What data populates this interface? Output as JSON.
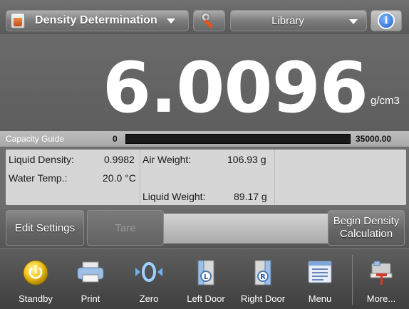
{
  "header": {
    "app_mode": "Density Determination",
    "library_label": "Library",
    "tools_icon": "wrench-icon",
    "info_icon": "info-icon",
    "info_glyph": "i"
  },
  "reading": {
    "value": "6.0096",
    "unit": "g/cm3"
  },
  "capacity_guide": {
    "label": "Capacity Guide",
    "min": "0",
    "max": "35000.00",
    "fill_fraction": 0.0
  },
  "info_panel": {
    "liquid_density_label": "Liquid Density:",
    "liquid_density_value": "0.9982",
    "water_temp_label": "Water Temp.:",
    "water_temp_value": "20.0 °C",
    "air_weight_label": "Air Weight:",
    "air_weight_value": "106.93 g",
    "liquid_weight_label": "Liquid Weight:",
    "liquid_weight_value": "89.17 g"
  },
  "actions": {
    "edit_settings": "Edit Settings",
    "tare": "Tare",
    "begin_line1": "Begin Density",
    "begin_line2": "Calculation"
  },
  "nav": [
    {
      "label": "Standby",
      "icon": "standby-icon"
    },
    {
      "label": "Print",
      "icon": "printer-icon"
    },
    {
      "label": "Zero",
      "icon": "zero-icon"
    },
    {
      "label": "Left Door",
      "icon": "left-door-icon"
    },
    {
      "label": "Right Door",
      "icon": "right-door-icon"
    },
    {
      "label": "Menu",
      "icon": "menu-icon"
    },
    {
      "label": "More...",
      "icon": "more-icon"
    }
  ],
  "colors": {
    "capacity_fill": "#5fbf3a",
    "info_blue": "#1f5fc8",
    "app_icon_orange": "#e06a2a"
  }
}
